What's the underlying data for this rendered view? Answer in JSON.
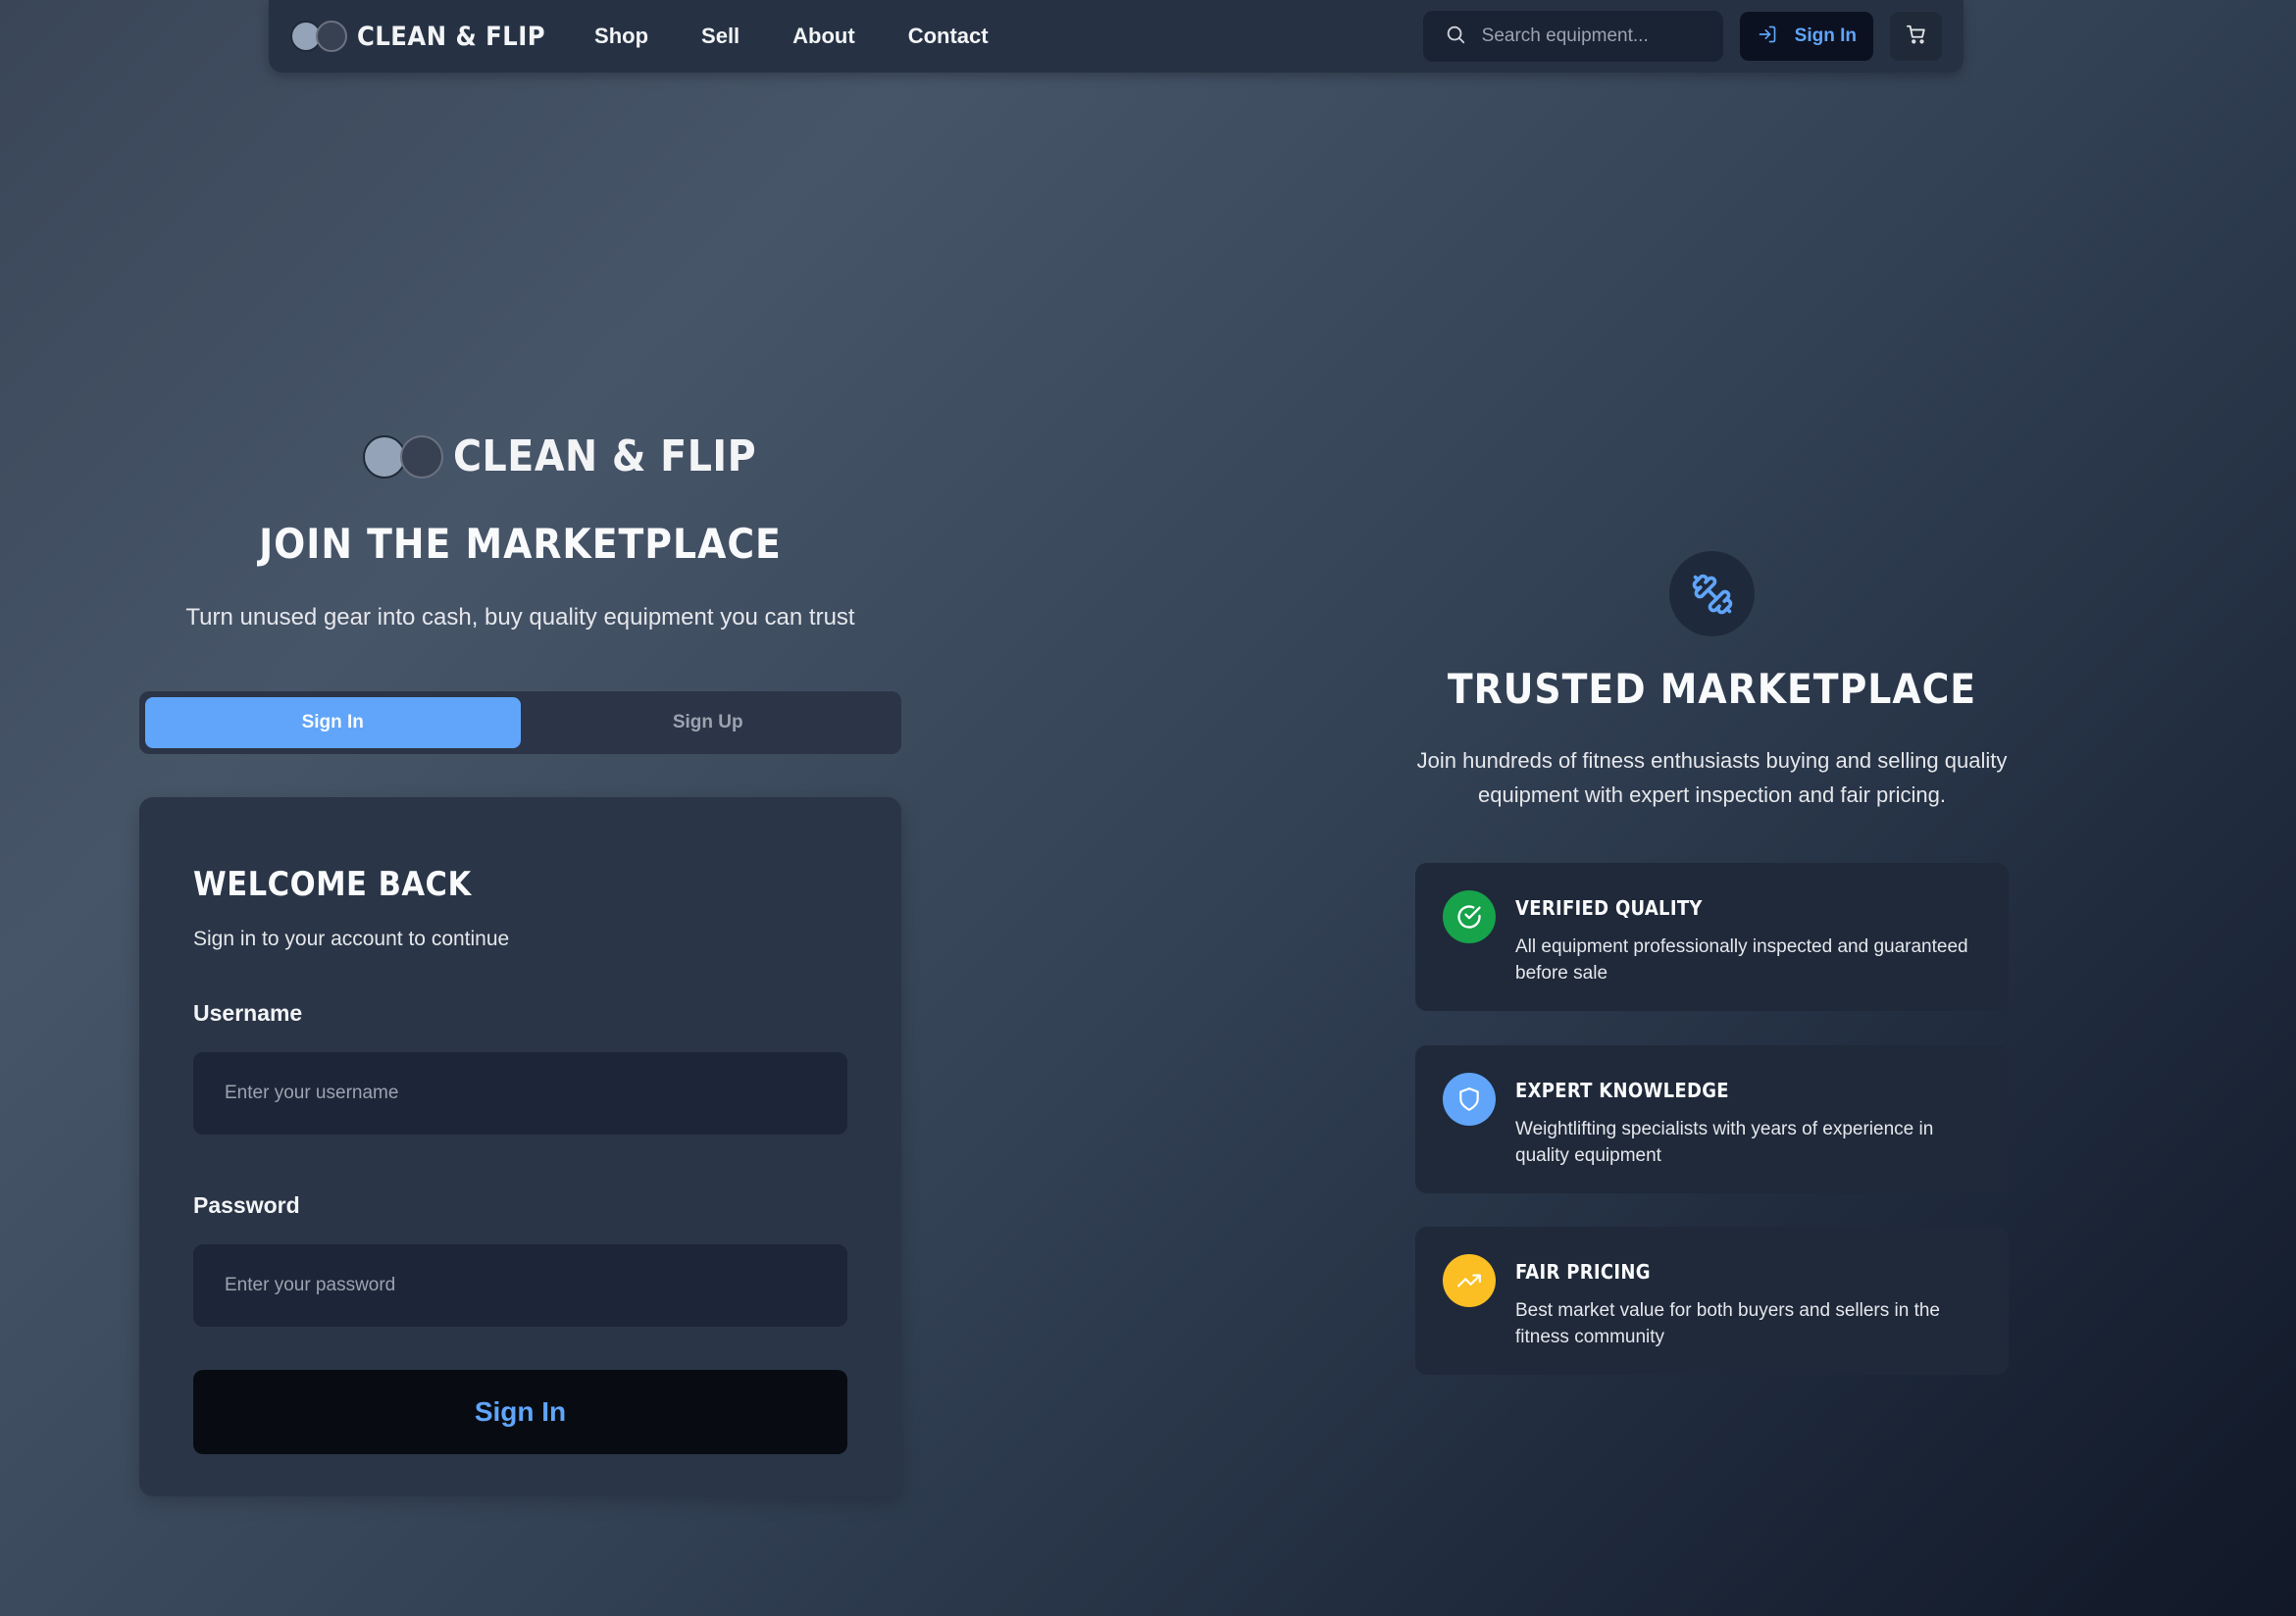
{
  "nav": {
    "brand": "CLEAN & FLIP",
    "links": [
      "Shop",
      "Sell",
      "About",
      "Contact"
    ],
    "search_placeholder": "Search equipment...",
    "signin_label": "Sign In"
  },
  "left": {
    "brand": "CLEAN & FLIP",
    "title": "JOIN THE MARKETPLACE",
    "subtitle": "Turn unused gear into cash, buy quality equipment you can trust",
    "tabs": [
      "Sign In",
      "Sign Up"
    ],
    "active_tab": "Sign In",
    "card": {
      "title": "WELCOME BACK",
      "subtitle": "Sign in to your account to continue",
      "username_label": "Username",
      "username_placeholder": "Enter your username",
      "password_label": "Password",
      "password_placeholder": "Enter your password",
      "submit_label": "Sign In"
    }
  },
  "right": {
    "icon": "dumbbell-icon",
    "title": "TRUSTED MARKETPLACE",
    "subtitle_line1": "Join hundreds of fitness enthusiasts buying and selling quality",
    "subtitle_line2": "equipment with expert inspection and fair pricing.",
    "features": [
      {
        "icon": "check-circle-icon",
        "color": "#16a34a",
        "title": "VERIFIED QUALITY",
        "desc_line1": "All equipment professionally inspected and guaranteed",
        "desc_line2": "before sale"
      },
      {
        "icon": "shield-icon",
        "color": "#60a5fa",
        "title": "EXPERT KNOWLEDGE",
        "desc_line1": "Weightlifting specialists with years of experience in",
        "desc_line2": "quality equipment"
      },
      {
        "icon": "trending-up-icon",
        "color": "#fbbf24",
        "title": "FAIR PRICING",
        "desc_line1": "Best market value for both buyers and sellers in the",
        "desc_line2": "fitness community"
      }
    ]
  },
  "colors": {
    "accent": "#60a5fa",
    "success": "#16a34a",
    "warning": "#fbbf24"
  }
}
